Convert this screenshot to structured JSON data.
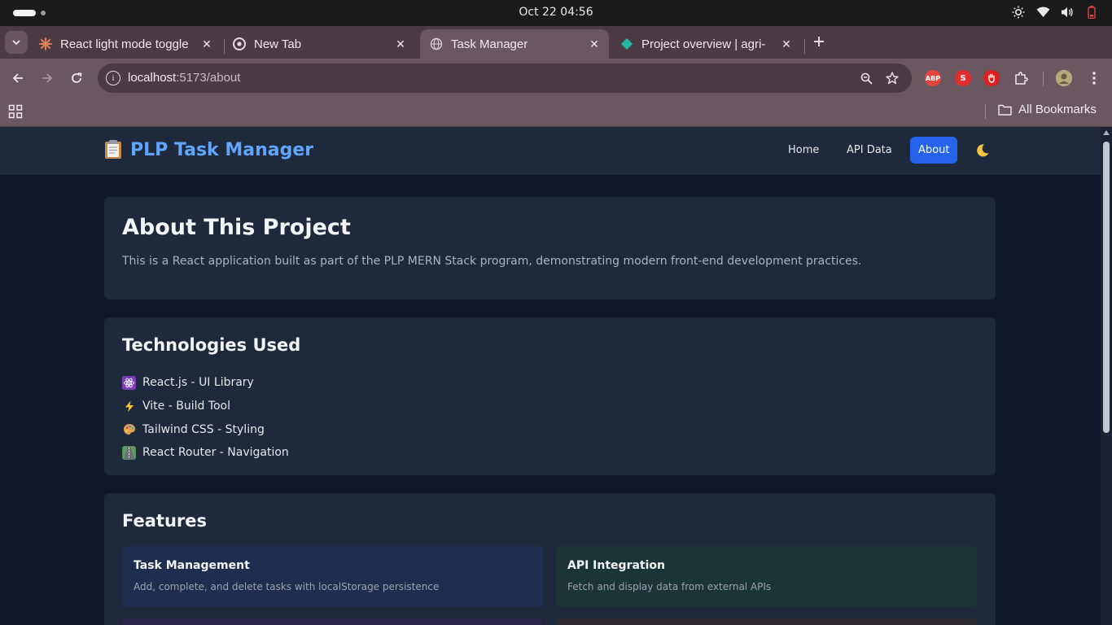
{
  "os": {
    "clock": "Oct 22  04:56"
  },
  "browser": {
    "tabs": [
      {
        "title": "React light mode toggle",
        "favicon": "claude-burst-icon",
        "active": false
      },
      {
        "title": "New Tab",
        "favicon": "chrome-icon",
        "active": false
      },
      {
        "title": "Task Manager",
        "favicon": "globe-icon",
        "active": true
      },
      {
        "title": "Project overview | agri-",
        "favicon": "diamond-icon",
        "active": false
      }
    ],
    "url_host": "localhost",
    "url_path": ":5173/about",
    "extensions": [
      "ABP",
      "S"
    ],
    "bookmarks_label": "All Bookmarks"
  },
  "app": {
    "brand_emoji": "📋",
    "brand_title": "PLP Task Manager",
    "nav": {
      "home": "Home",
      "api_data": "API Data",
      "about": "About",
      "active": "About"
    },
    "theme_toggle": "🌙"
  },
  "about": {
    "title": "About This Project",
    "description": "This is a React application built as part of the PLP MERN Stack program, demonstrating modern front-end development practices."
  },
  "technologies": {
    "title": "Technologies Used",
    "items": [
      {
        "emoji": "⚛️",
        "label": "React.js - UI Library"
      },
      {
        "emoji": "⚡",
        "label": "Vite - Build Tool"
      },
      {
        "emoji": "🎨",
        "label": "Tailwind CSS - Styling"
      },
      {
        "emoji": "🛣️",
        "label": "React Router - Navigation"
      }
    ]
  },
  "features": {
    "title": "Features",
    "items": [
      {
        "title": "Task Management",
        "description": "Add, complete, and delete tasks with localStorage persistence",
        "color": "#1f2e4f"
      },
      {
        "title": "API Integration",
        "description": "Fetch and display data from external APIs",
        "color": "#1b3438"
      }
    ]
  },
  "colors": {
    "accent": "#60a5fa",
    "active_nav": "#2563eb",
    "page_bg": "#0f172a",
    "card_bg": "#1e293b"
  }
}
